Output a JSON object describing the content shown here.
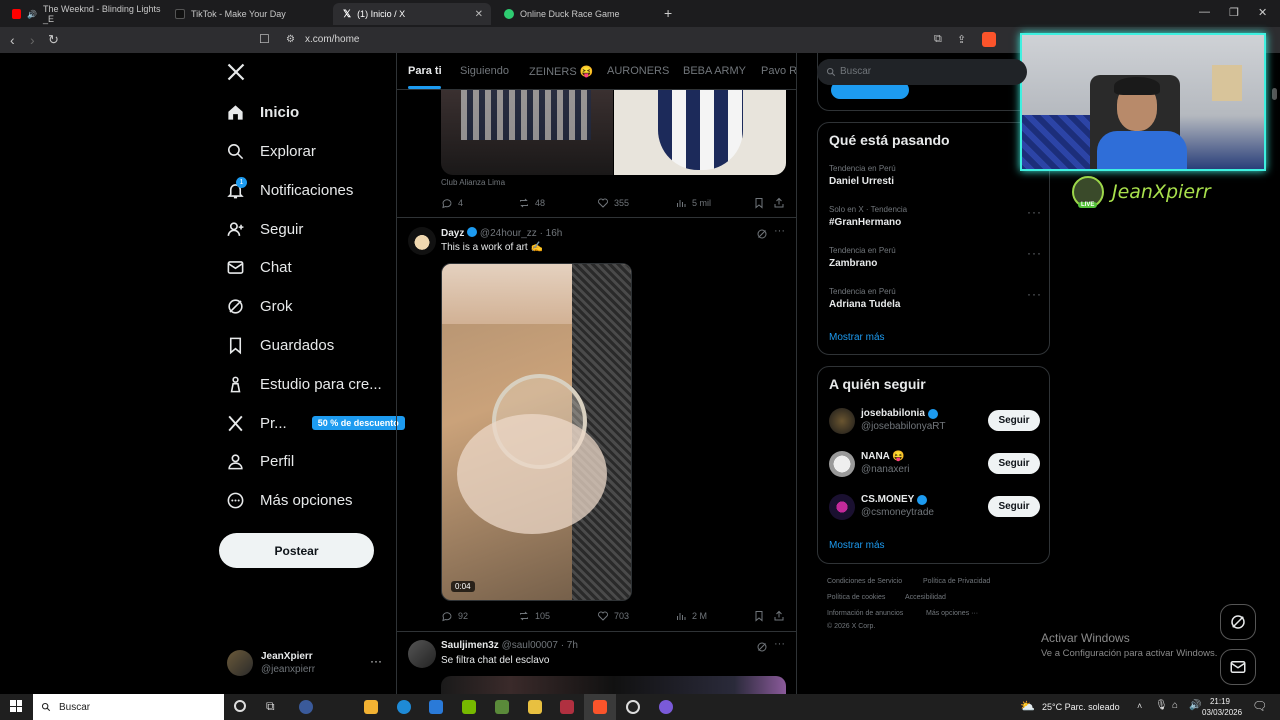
{
  "browser": {
    "tabs": [
      {
        "label": "The Weeknd - Blinding Lights _E",
        "color": "#ff0000"
      },
      {
        "label": "TikTok - Make Your Day",
        "color": "#ffffff"
      },
      {
        "label": "(1) Inicio / X",
        "color": "#ffffff"
      },
      {
        "label": "Online Duck Race Game",
        "color": "#2ecc71"
      }
    ],
    "url": "x.com/home",
    "new_tab": "+"
  },
  "sidebar": {
    "items": [
      {
        "label": "Inicio",
        "icon": "home-icon"
      },
      {
        "label": "Explorar",
        "icon": "search-icon"
      },
      {
        "label": "Notificaciones",
        "icon": "bell-icon"
      },
      {
        "label": "Seguir",
        "icon": "person-add-icon"
      },
      {
        "label": "Chat",
        "icon": "mail-icon"
      },
      {
        "label": "Grok",
        "icon": "grok-icon"
      },
      {
        "label": "Guardados",
        "icon": "bookmark-icon"
      },
      {
        "label": "Estudio para cre...",
        "icon": "studio-icon"
      },
      {
        "label": "Pr...",
        "icon": "x-logo-icon"
      },
      {
        "label": "Perfil",
        "icon": "profile-icon"
      },
      {
        "label": "Más opciones",
        "icon": "more-icon"
      }
    ],
    "notification_count": "1",
    "promo_badge": "50 % de descuento",
    "post_label": "Postear",
    "account": {
      "name": "JeanXpierr",
      "handle": "@jeanxpierr"
    }
  },
  "feed": {
    "tabs": [
      "Para ti",
      "Siguiendo",
      "ZEINERS 😝",
      "AURONERS",
      "BEBA ARMY",
      "Pavo Ra"
    ],
    "tweet0": {
      "source": "Club Alianza Lima",
      "replies": "4",
      "reposts": "48",
      "likes": "355",
      "views": "5 mil"
    },
    "tweet1": {
      "name": "Dayz",
      "handle": "@24hour_zz",
      "time": "· 16h",
      "text": "This is a work of art ✍️",
      "video_time": "0:04",
      "replies": "92",
      "reposts": "105",
      "likes": "703",
      "views": "2 M"
    },
    "tweet2": {
      "name": "Sauljimen3z",
      "handle": "@saul00007",
      "time": "· 7h",
      "text": "Se filtra chat del esclavo"
    }
  },
  "right": {
    "search_placeholder": "Buscar",
    "trending_title": "Qué está pasando",
    "trends": [
      {
        "sub": "Tendencia en Perú",
        "title": "Daniel Urresti"
      },
      {
        "sub": "Solo en X · Tendencia",
        "title": "#GranHermano"
      },
      {
        "sub": "Tendencia en Perú",
        "title": "Zambrano"
      },
      {
        "sub": "Tendencia en Perú",
        "title": "Adriana Tudela"
      }
    ],
    "trend_more": "Mostrar más",
    "follow_title": "A quién seguir",
    "follow": [
      {
        "name": "josebabilonia",
        "handle": "@josebabilonyaRT",
        "button": "Seguir"
      },
      {
        "name": "NANA 😝",
        "handle": "@nanaxeri",
        "button": "Seguir"
      },
      {
        "name": "CS.MONEY",
        "handle": "@csmoneytrade",
        "button": "Seguir"
      }
    ],
    "follow_more": "Mostrar más",
    "footer": [
      "Condiciones de Servicio",
      "Política de Privacidad",
      "Política de cookies",
      "Accesibilidad",
      "Información de anuncios",
      "Más opciones ···",
      "© 2026 X Corp."
    ]
  },
  "overlay": {
    "streamer_name": "JeanXpierr",
    "live": "LIVE",
    "activate_title": "Activar Windows",
    "activate_sub": "Ve a Configuración para activar Windows."
  },
  "taskbar": {
    "search": "Buscar",
    "weather": "25°C  Parc. soleado",
    "time": "21:19",
    "date": "03/03/2026"
  },
  "colors": {
    "accent": "#1d9bf0",
    "bg": "#000000",
    "border": "#2f3336",
    "muted": "#71767b"
  }
}
